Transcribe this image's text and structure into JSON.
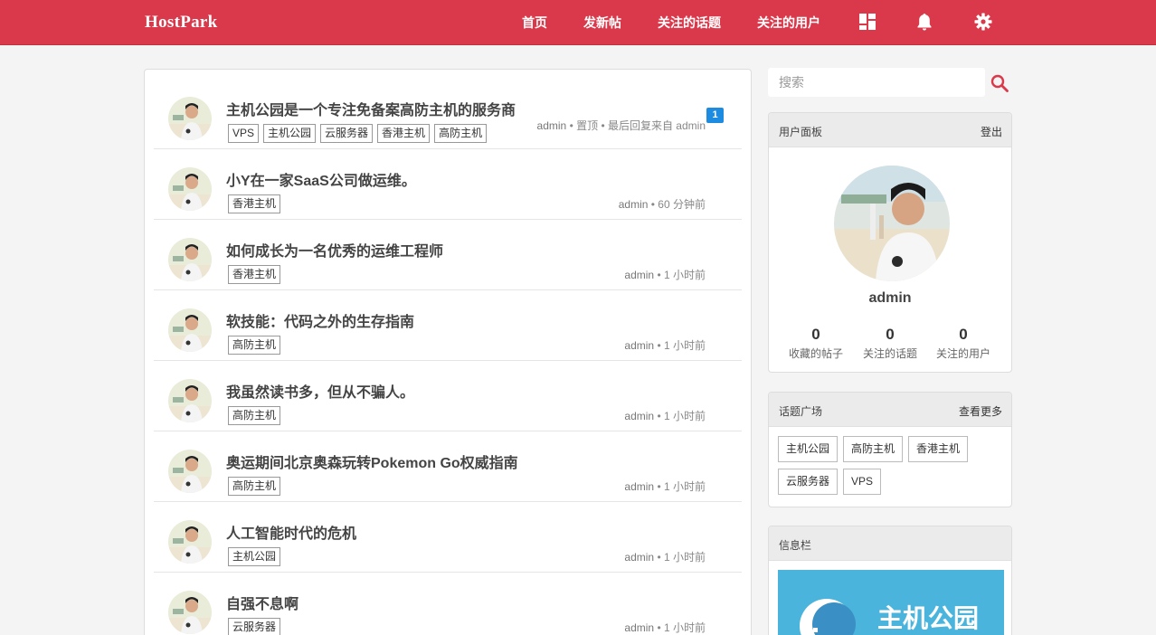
{
  "header": {
    "brand": "HostPark",
    "nav": [
      "首页",
      "发新帖",
      "关注的话题",
      "关注的用户"
    ],
    "icons": [
      "dashboard-icon",
      "bell-icon",
      "gear-icon"
    ],
    "accent": "#d9394a"
  },
  "topics": [
    {
      "title": "主机公园是一个专注免备案高防主机的服务商",
      "tags": [
        "VPS",
        "主机公园",
        "云服务器",
        "香港主机",
        "高防主机"
      ],
      "author": "admin",
      "info": " • 置顶 • 最后回复来自 admin",
      "badge": "1"
    },
    {
      "title": "小Y在一家SaaS公司做运维。",
      "tags": [
        "香港主机"
      ],
      "author": "admin",
      "info": " • 60 分钟前"
    },
    {
      "title": "如何成长为一名优秀的运维工程师",
      "tags": [
        "香港主机"
      ],
      "author": "admin",
      "info": " • 1 小时前"
    },
    {
      "title": "软技能：代码之外的生存指南",
      "tags": [
        "高防主机"
      ],
      "author": "admin",
      "info": " • 1 小时前"
    },
    {
      "title": "我虽然读书多，但从不骗人。",
      "tags": [
        "高防主机"
      ],
      "author": "admin",
      "info": " • 1 小时前"
    },
    {
      "title": "奥运期间北京奥森玩转Pokemon Go权威指南",
      "tags": [
        "高防主机"
      ],
      "author": "admin",
      "info": " • 1 小时前"
    },
    {
      "title": "人工智能时代的危机",
      "tags": [
        "主机公园"
      ],
      "author": "admin",
      "info": " • 1 小时前"
    },
    {
      "title": "自强不息啊",
      "tags": [
        "云服务器"
      ],
      "author": "admin",
      "info": " • 1 小时前"
    }
  ],
  "sidebar": {
    "search_placeholder": "搜索",
    "user_panel": {
      "title": "用户面板",
      "logout": "登出",
      "username": "admin",
      "stats": [
        {
          "value": "0",
          "label": "收藏的帖子"
        },
        {
          "value": "0",
          "label": "关注的话题"
        },
        {
          "value": "0",
          "label": "关注的用户"
        }
      ]
    },
    "topic_square": {
      "title": "话题广场",
      "more": "查看更多",
      "tags": [
        "主机公园",
        "高防主机",
        "香港主机",
        "云服务器",
        "VPS"
      ]
    },
    "info_panel": {
      "title": "信息栏",
      "banner_text": "主机公园"
    }
  }
}
